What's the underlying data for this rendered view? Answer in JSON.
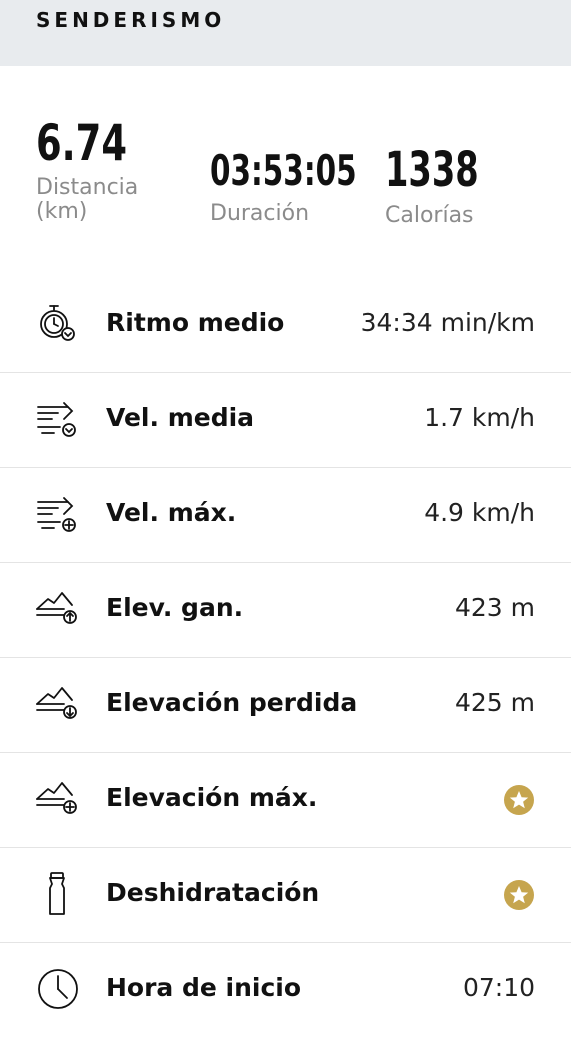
{
  "header": {
    "title": "SENDERISMO"
  },
  "summary": {
    "distance": {
      "value": "6.74",
      "label_line1": "Distancia",
      "label_line2": "(km)"
    },
    "duration": {
      "value": "03:53:05",
      "label": "Duración"
    },
    "calories": {
      "value": "1338",
      "label": "Calorías"
    }
  },
  "metrics": [
    {
      "icon": "stopwatch-pace-icon",
      "label": "Ritmo medio",
      "value": "34:34 min/km"
    },
    {
      "icon": "speed-average-icon",
      "label": "Vel. media",
      "value": "1.7 km/h"
    },
    {
      "icon": "speed-max-icon",
      "label": "Vel. máx.",
      "value": "4.9 km/h"
    },
    {
      "icon": "elevation-gain-icon",
      "label": "Elev. gan.",
      "value": "423 m"
    },
    {
      "icon": "elevation-loss-icon",
      "label": "Elevación perdida",
      "value": "425 m"
    },
    {
      "icon": "elevation-max-icon",
      "label": "Elevación máx.",
      "premium": true
    },
    {
      "icon": "bottle-icon",
      "label": "Deshidratación",
      "premium": true
    },
    {
      "icon": "clock-icon",
      "label": "Hora de inicio",
      "value": "07:10"
    }
  ],
  "colors": {
    "header_bg": "#e8ebee",
    "premium_badge": "#c6a54e",
    "label_gray": "#8b8b8b"
  }
}
